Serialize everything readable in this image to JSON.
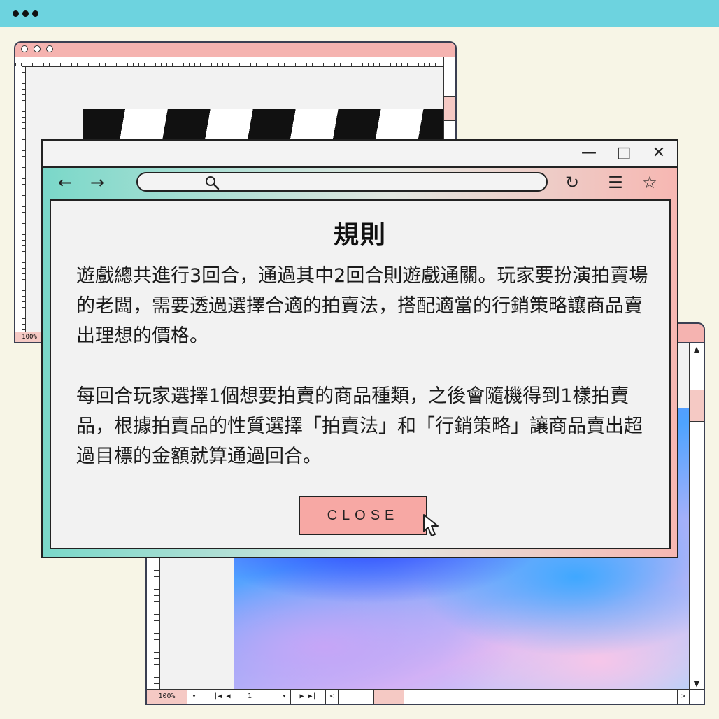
{
  "top_bar": {
    "dots_icon": "more-dots-icon"
  },
  "back_window_top": {
    "zoom": "100%"
  },
  "back_window_bottom": {
    "zoom": "100%",
    "page": "1"
  },
  "browser": {
    "title_buttons": {
      "minimize": "—",
      "maximize": "□",
      "close": "✕"
    },
    "nav": {
      "back": "←",
      "forward": "→",
      "reload": "↻",
      "menu": "☰",
      "star": "☆"
    },
    "url_value": ""
  },
  "dialog": {
    "title": "規則",
    "paragraph1": "遊戲總共進行3回合，通過其中2回合則遊戲通關。玩家要扮演拍賣場的老闆，需要透過選擇合適的拍賣法，搭配適當的行銷策略讓商品賣出理想的價格。",
    "paragraph2": "每回合玩家選擇1個想要拍賣的商品種類，之後會隨機得到1樣拍賣品，根據拍賣品的性質選擇「拍賣法」和「行銷策略」讓商品賣出超過目標的金額就算通過回合。",
    "close_label": "CLOSE"
  },
  "colors": {
    "top_bar": "#6dd3df",
    "background": "#f7f5e6",
    "close_button": "#f7a8a4",
    "gradient_left": "#7ad8c9",
    "gradient_right": "#f7b7b2"
  }
}
